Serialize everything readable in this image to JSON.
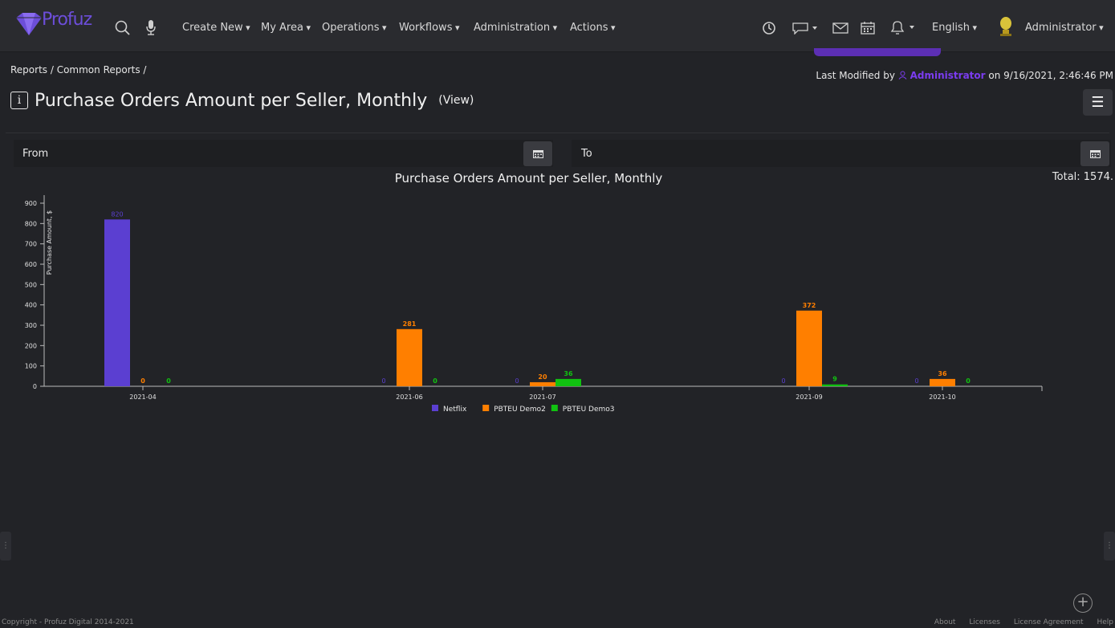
{
  "header": {
    "logo_text": "Profuz",
    "menu": [
      "Create New",
      "My Area",
      "Operations",
      "Workflows",
      "Administration",
      "Actions"
    ],
    "language": "English",
    "user": "Administrator"
  },
  "breadcrumb": "Reports / Common Reports /",
  "last_modified": {
    "prefix": "Last Modified by",
    "user": "Administrator",
    "suffix": "on 9/16/2021, 2:46:46 PM"
  },
  "page": {
    "info_icon": "i",
    "title": "Purchase Orders Amount per Seller, Monthly",
    "view_link": "(View)"
  },
  "filters": {
    "from_label": "From",
    "to_label": "To"
  },
  "chart_title": "Purchase Orders Amount per Seller, Monthly",
  "total": "Total: 1574.",
  "chart_data": {
    "type": "bar",
    "title": "Purchase Orders Amount per Seller, Monthly",
    "ylabel": "Purchase Amount, $",
    "xlabel": "",
    "ylim": [
      0,
      900
    ],
    "y_ticks": [
      0,
      100,
      200,
      300,
      400,
      500,
      600,
      700,
      800,
      900
    ],
    "x_range": [
      "2021-04",
      "2021-10"
    ],
    "categories": [
      "2021-04",
      "2021-06",
      "2021-07",
      "2021-09",
      "2021-10"
    ],
    "category_month_index": [
      0,
      2,
      3,
      5,
      6
    ],
    "legend_position": "bottom-center",
    "series": [
      {
        "name": "Netflix",
        "color": "#5b3fd1",
        "values": [
          820,
          0,
          0,
          0,
          0
        ]
      },
      {
        "name": "PBTEU Demo2",
        "color": "#ff7f00",
        "values": [
          0,
          281,
          20,
          372,
          36
        ]
      },
      {
        "name": "PBTEU Demo3",
        "color": "#11c211",
        "values": [
          0,
          0,
          36,
          9,
          0
        ]
      }
    ]
  },
  "footer": {
    "copyright": "Copyright - Profuz Digital 2014-2021",
    "links": [
      "About",
      "Licenses",
      "License Agreement",
      "Help"
    ]
  },
  "colors": {
    "accent": "#7b3cf0",
    "background": "#222327",
    "topbar": "#2a2b2f"
  },
  "icons": [
    "logo-icon",
    "search-icon",
    "microphone-icon",
    "history-icon",
    "chat-icon",
    "mail-icon",
    "calendar-icon",
    "bell-icon",
    "avatar-icon",
    "info-icon",
    "hamburger-icon",
    "plus-icon"
  ]
}
